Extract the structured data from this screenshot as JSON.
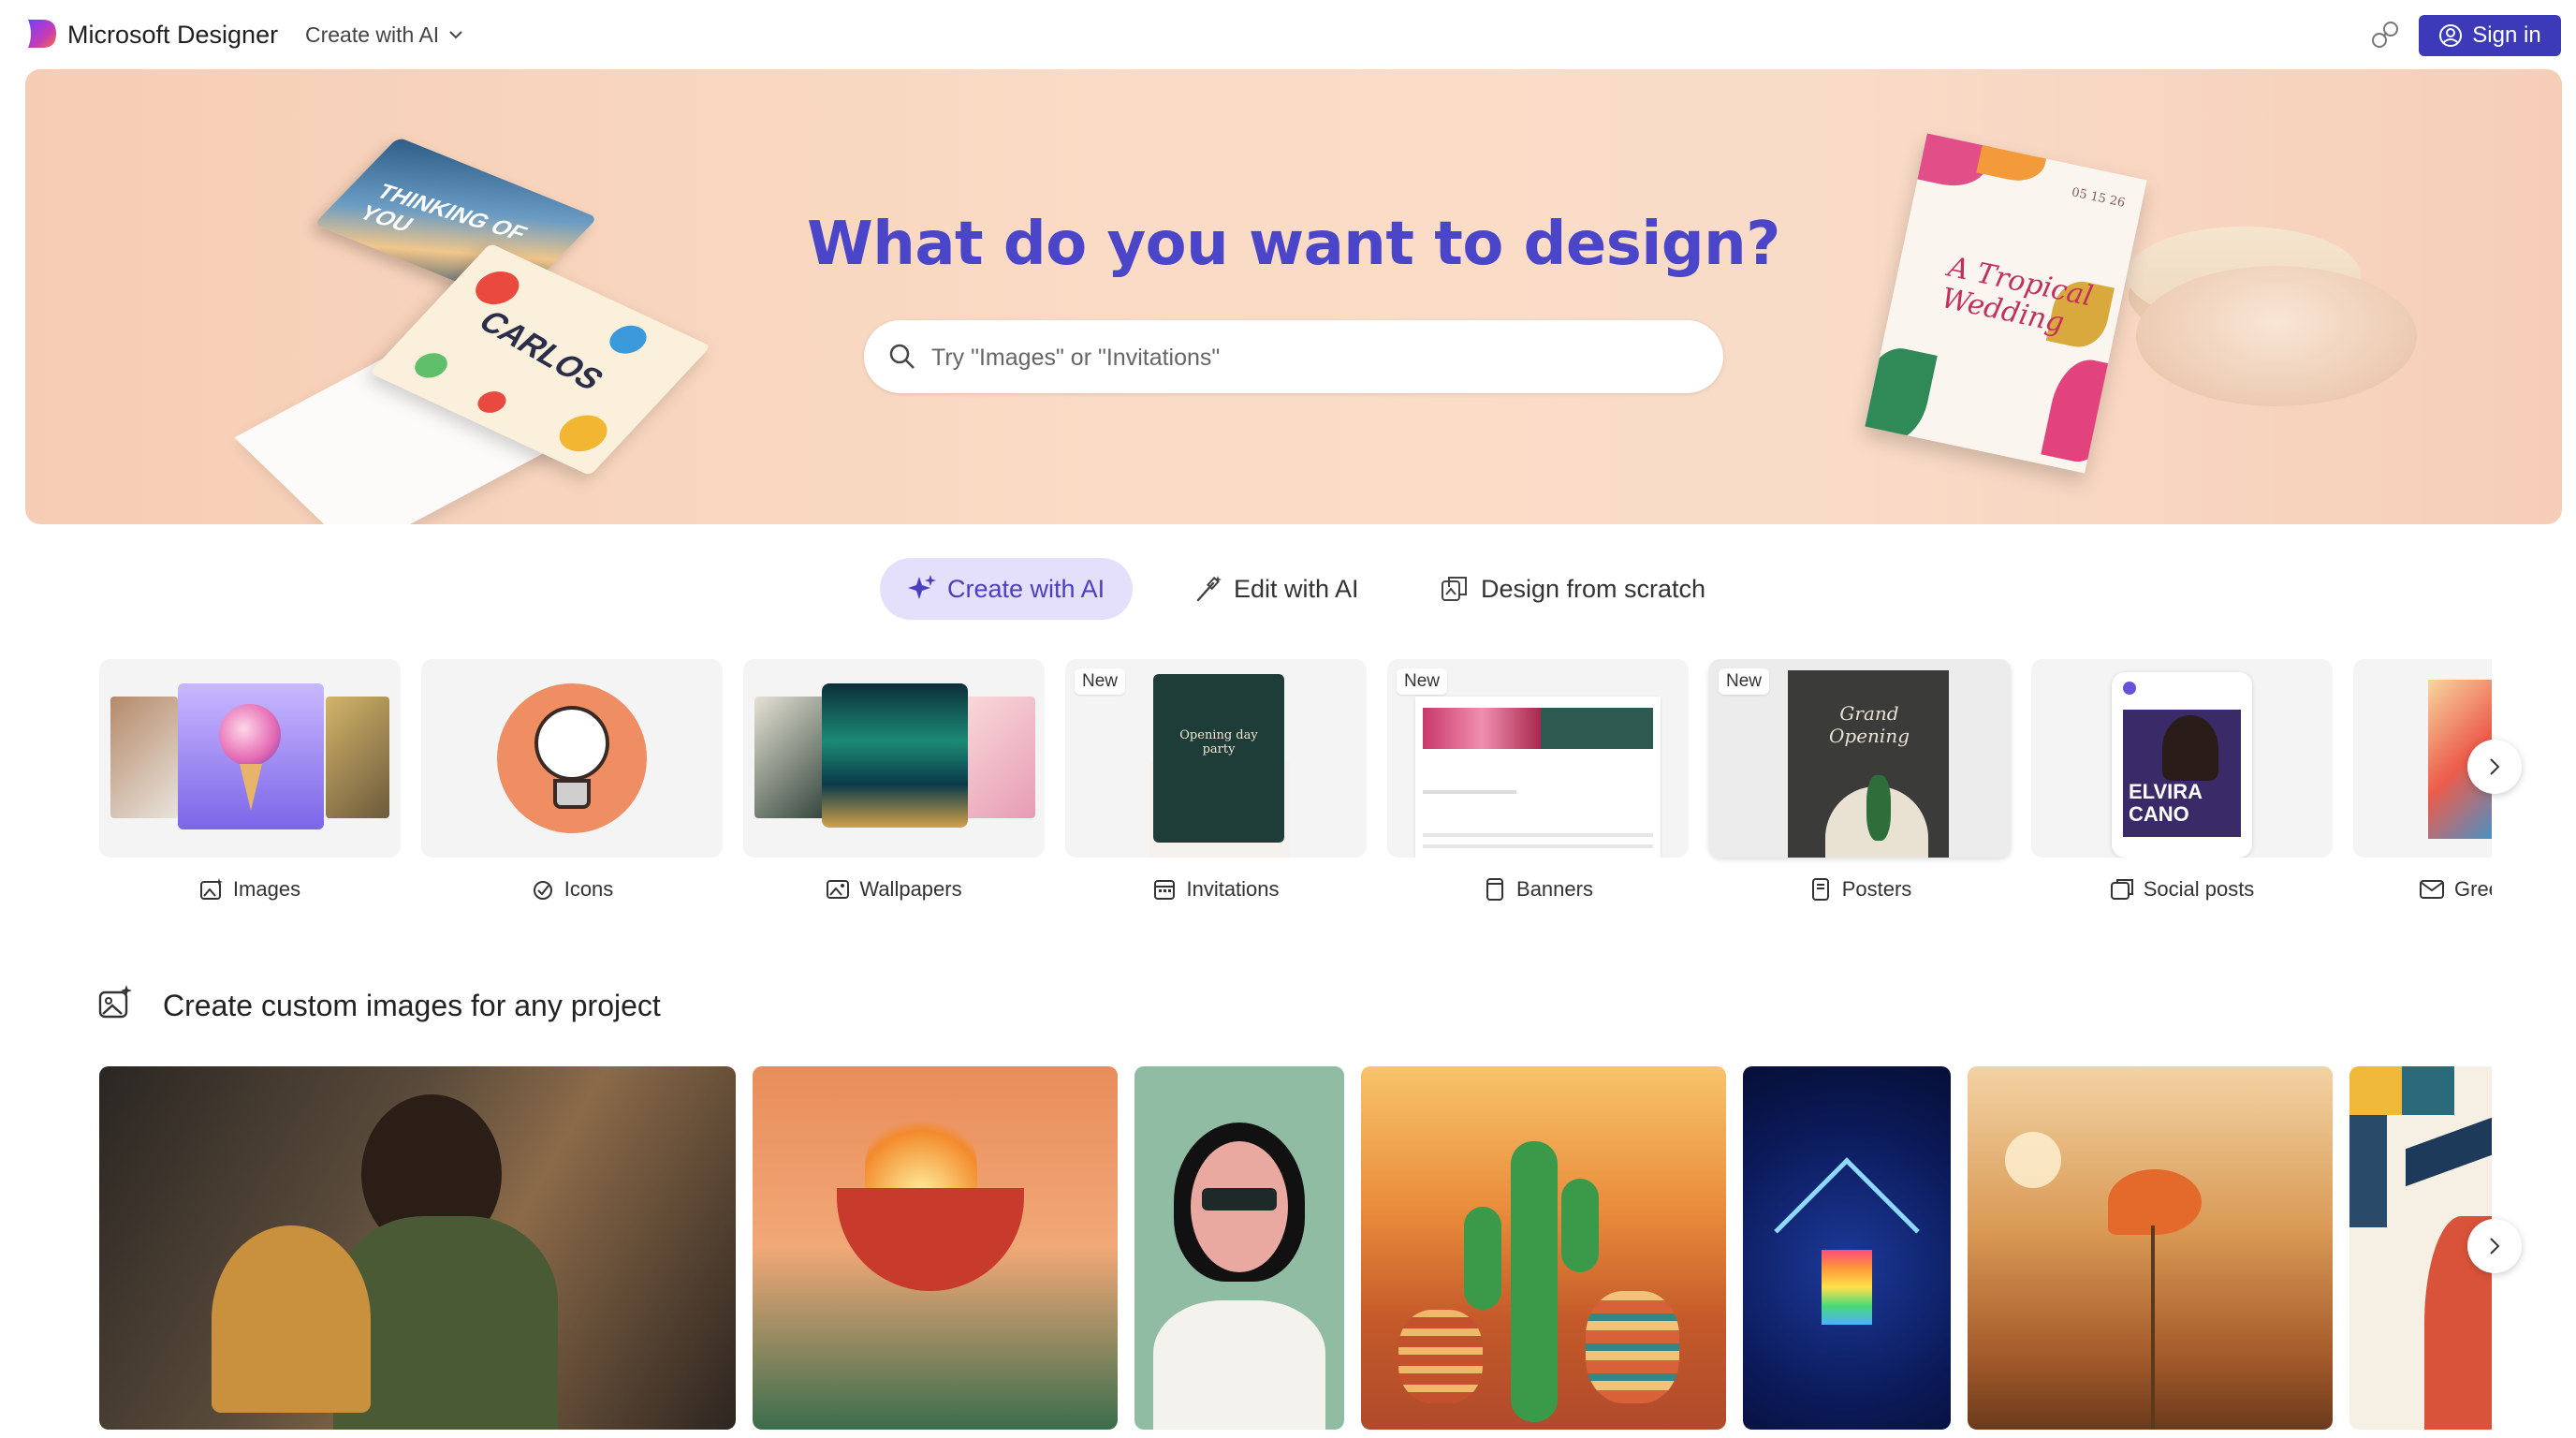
{
  "header": {
    "brand": "Microsoft Designer",
    "mode_dropdown": "Create with AI",
    "signin_label": "Sign in"
  },
  "hero": {
    "title": "What do you want to design?",
    "search_placeholder": "Try \"Images\" or \"Invitations\"",
    "card1_text": "THINKING OF YOU",
    "card2_text": "CARLOS",
    "invite_text": "A Tropical Wedding",
    "invite_date": "05 15 26"
  },
  "tabs": [
    {
      "label": "Create with AI",
      "icon": "sparkle-icon",
      "active": true
    },
    {
      "label": "Edit with AI",
      "icon": "magic-wand-icon",
      "active": false
    },
    {
      "label": "Design from scratch",
      "icon": "design-icon",
      "active": false
    }
  ],
  "categories": [
    {
      "label": "Images",
      "icon": "image-icon",
      "new": false
    },
    {
      "label": "Icons",
      "icon": "icon-shape-icon",
      "new": false
    },
    {
      "label": "Wallpapers",
      "icon": "wallpaper-icon",
      "new": false
    },
    {
      "label": "Invitations",
      "icon": "calendar-icon",
      "new": true,
      "thumb_text": "Opening day party"
    },
    {
      "label": "Banners",
      "icon": "banner-icon",
      "new": true
    },
    {
      "label": "Posters",
      "icon": "poster-icon",
      "new": true,
      "thumb_text": "Grand Opening"
    },
    {
      "label": "Social posts",
      "icon": "social-post-icon",
      "new": false,
      "thumb_text": "ELVIRA CANO"
    },
    {
      "label": "Gree",
      "icon": "mail-icon",
      "new": false
    }
  ],
  "new_badge": "New",
  "section": {
    "title": "Create custom images for any project"
  },
  "colors": {
    "accent": "#4b45c9",
    "signin_bg": "#3c3ab8",
    "active_tab_bg": "#e4e0fb",
    "hero_bg": "#f8d6c0"
  }
}
